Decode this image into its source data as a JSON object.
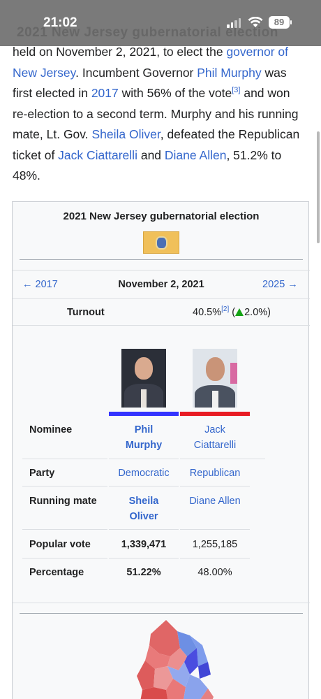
{
  "status_bar": {
    "time": "21:02",
    "battery": "89",
    "behind_text": "2021 New Jersey gubernatorial election"
  },
  "article": {
    "t1": "held on November 2, 2021, to elect the ",
    "link_governor": "governor of New Jersey",
    "t2": ". Incumbent Governor ",
    "link_murphy": "Phil Murphy",
    "t3": " was first elected in ",
    "link_2017": "2017",
    "t4": " with 56% of the vote",
    "ref3": "[3]",
    "t5": " and won re-election to a second term. Murphy and his running mate, Lt. Gov. ",
    "link_oliver": "Sheila Oliver",
    "t6": ", defeated the Republican ticket of ",
    "link_ciattarelli": "Jack Ciattarelli",
    "t7": " and ",
    "link_allen": "Diane Allen",
    "t8": ", 51.2% to 48%."
  },
  "infobox": {
    "title": "2021 New Jersey gubernatorial election",
    "prev": "← 2017",
    "date": "November 2, 2021",
    "next": "2025 →",
    "turnout_label": "Turnout",
    "turnout_value": "40.5%",
    "turnout_ref": "[2]",
    "turnout_open": " (",
    "turnout_change": "2.0%)",
    "colors": {
      "democratic": "#3333ff",
      "republican": "#e81b23"
    },
    "rows": {
      "nominee_label": "Nominee",
      "party_label": "Party",
      "running_mate_label": "Running mate",
      "popular_vote_label": "Popular vote",
      "percentage_label": "Percentage"
    },
    "candidates": [
      {
        "nominee": "Phil Murphy",
        "party": "Democratic",
        "running_mate": "Sheila Oliver",
        "popular_vote": "1,339,471",
        "percentage": "51.22%"
      },
      {
        "nominee": "Jack Ciattarelli",
        "party": "Republican",
        "running_mate": "Diane Allen",
        "popular_vote": "1,255,185",
        "percentage": "48.00%"
      }
    ]
  }
}
